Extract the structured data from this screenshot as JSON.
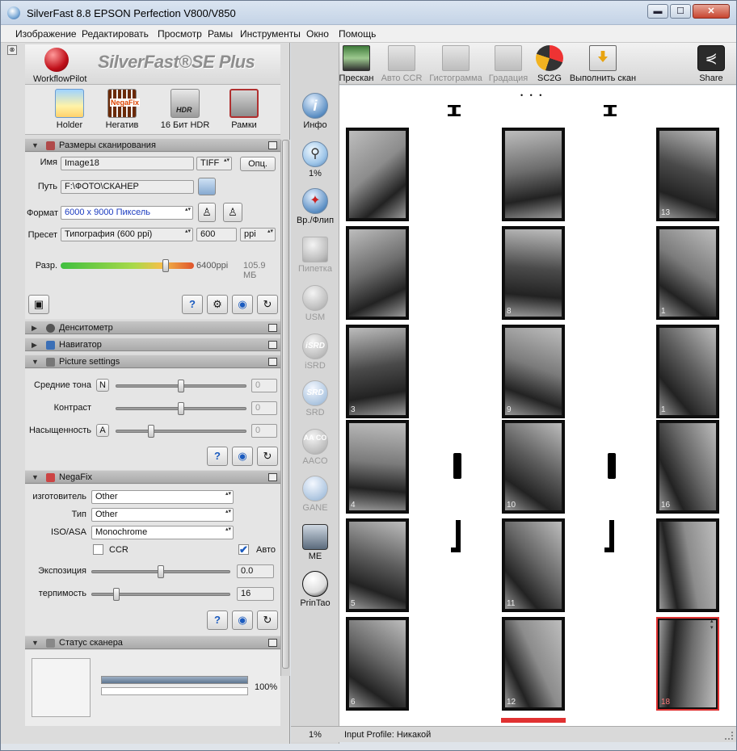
{
  "window": {
    "title": "SilverFast 8.8 EPSON Perfection V800/V850",
    "min": "▬",
    "max": "☐",
    "close": "✕"
  },
  "menu": [
    "Изображение",
    "Редактировать",
    "Просмотр",
    "Рамы",
    "Инструменты",
    "Окно",
    "Помощь"
  ],
  "logo": {
    "workflow": "WorkflowPilot",
    "brand": "SilverFast®SE Plus"
  },
  "modes": [
    "Holder",
    "Негатив",
    "16 Бит HDR",
    "Рамки"
  ],
  "mode_icon_text": {
    "negafix": "NegaFix",
    "hdr": "HDR"
  },
  "scan_size": {
    "title": "Размеры сканирования",
    "name_label": "Имя",
    "name_value": "Image18",
    "format_value": "TIFF",
    "options_btn": "Опц.",
    "path_label": "Путь",
    "path_value": "F:\\ФОТО\\СКАНЕР",
    "frame_label": "Формат",
    "frame_value": "6000 x 9000 Пиксель",
    "preset_label": "Пресет",
    "preset_value": "Типография (600 ppi)",
    "ppi_value": "600",
    "ppi_unit": "ppi",
    "res_label": "Разр.",
    "res_value": "6400ppi",
    "size_value": "105.9 МБ",
    "res_level": 0.79
  },
  "sections": {
    "densitometer": "Денситометр",
    "navigator": "Навигатор",
    "picture": "Picture settings",
    "negafix": "NegaFix",
    "scanner_status": "Статус сканера"
  },
  "picture": {
    "midtones_label": "Средние тона",
    "midtones_btn": "N",
    "midtones_value": "0",
    "contrast_label": "Контраст",
    "contrast_value": "0",
    "saturation_label": "Насыщенность",
    "saturation_btn": "A",
    "saturation_value": "0",
    "midtones_level": 0.5,
    "contrast_level": 0.5,
    "saturation_level": 0.27
  },
  "negafix": {
    "maker_label": "изготовитель",
    "maker_value": "Other",
    "type_label": "Тип",
    "type_value": "Other",
    "iso_label": "ISO/ASA",
    "iso_value": "Monochrome",
    "ccr_label": "CCR",
    "ccr_checked": false,
    "auto_label": "Авто",
    "auto_checked": true,
    "exposure_label": "Экспозиция",
    "exposure_value": "0.0",
    "exposure_level": 0.5,
    "tolerance_label": "терпимость",
    "tolerance_value": "16",
    "tolerance_level": 0.18
  },
  "scanner_status": {
    "progress_text": "100%",
    "progress": 1.0
  },
  "toolbar": [
    "Прескан",
    "Авто CCR",
    "Гистограмма",
    "Градация",
    "SC2G",
    "Выполнить скан",
    "Share"
  ],
  "tools": [
    {
      "label": "Инфо",
      "icon": "info-icon",
      "enabled": true
    },
    {
      "label": "1%",
      "icon": "zoom-icon",
      "enabled": true
    },
    {
      "label": "Вр./Флип",
      "icon": "compass-icon",
      "enabled": true
    },
    {
      "label": "Пипетка",
      "icon": "pipette-icon",
      "enabled": false
    },
    {
      "label": "USM",
      "icon": "usm-icon",
      "enabled": false
    },
    {
      "label": "iSRD",
      "icon": "isrd-icon",
      "enabled": false
    },
    {
      "label": "SRD",
      "icon": "srd-icon",
      "enabled": false
    },
    {
      "label": "AACO",
      "icon": "aaco-icon",
      "enabled": false
    },
    {
      "label": "GANE",
      "icon": "gane-icon",
      "enabled": false
    },
    {
      "label": "ME",
      "icon": "me-icon",
      "enabled": true
    },
    {
      "label": "PrinTao",
      "icon": "printao-icon",
      "enabled": true
    }
  ],
  "tool_icon_text": {
    "isrd": "iSRD",
    "srd": "SRD",
    "aaco": "AA CO"
  },
  "frame_numbers": {
    "left": [
      "",
      "",
      "3",
      "4",
      "5",
      "6"
    ],
    "middle": [
      "",
      "8",
      "9",
      "10",
      "11",
      "12"
    ],
    "right": [
      "13",
      "1",
      "1",
      "16",
      "",
      "18"
    ]
  },
  "status": {
    "zoom": "1%",
    "profile": "Input Profile: Никакой"
  },
  "colors": {
    "accent": "#3b6fb6",
    "selection": "#e03131",
    "link_blue": "#1b3bbf"
  }
}
